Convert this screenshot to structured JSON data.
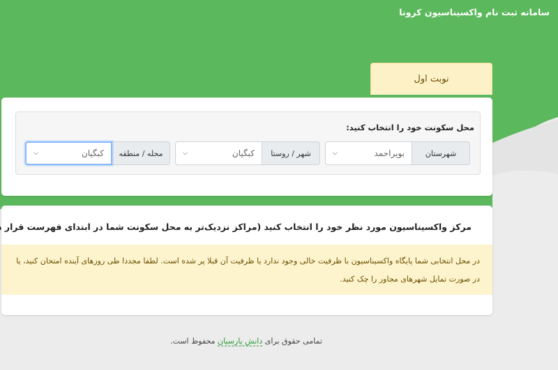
{
  "app": {
    "title": "سامانه ثبت نام واکسیناسیون کرونا"
  },
  "colors": {
    "brand_green": "#5cb85c",
    "alert_bg": "#fdf3cd",
    "alert_text": "#6a5000"
  },
  "turn_tab": {
    "label": "نوبت اول"
  },
  "residence": {
    "label": "محل سکونت خود را انتخاب کنید:",
    "fields": [
      {
        "label": "شهرستان",
        "value": "بویراحمد"
      },
      {
        "label": "شهر / روستا",
        "value": "کبگیان"
      },
      {
        "label": "محله / منطقه",
        "value": "کبگیان"
      }
    ]
  },
  "center": {
    "heading": "مرکز واکسیناسیون مورد نظر خود را انتخاب کنید (مراکز نزدیک‌تر به محل سکونت شما در ابتدای فهرست قرار دارند)",
    "alert": "در محل انتخابی شما پایگاه واکسیناسیون با ظرفیت خالی وجود ندارد یا ظرفیت آن قبلا پر شده است. لطفا مجددا طی روزهای آینده امتحان کنید، یا در صورت تمایل شهرهای مجاور را چک کنید."
  },
  "footer": {
    "prefix": "تمامی حقوق برای",
    "link": "دانش پارسیان",
    "suffix": "محفوظ است."
  },
  "icons": {
    "dropdown": "chevron-down-icon"
  }
}
